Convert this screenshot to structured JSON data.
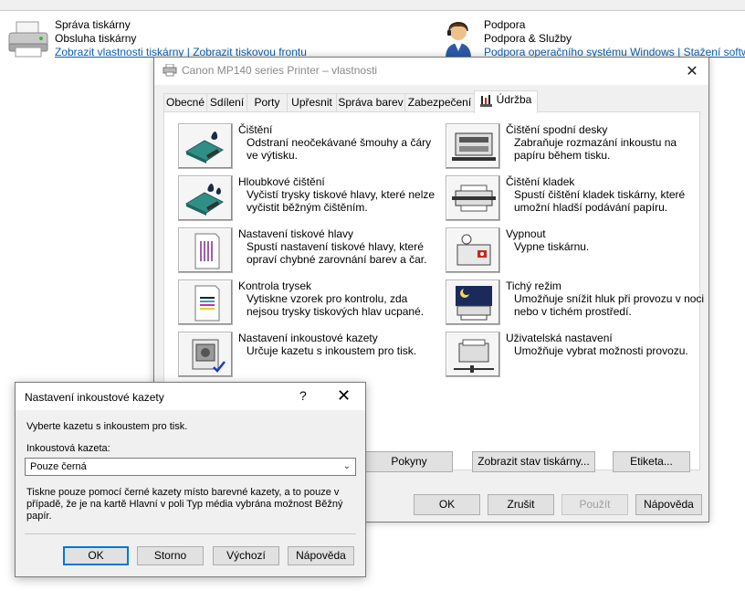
{
  "background": {
    "printer": {
      "title": "Správa tiskárny",
      "subtitle": "Obsluha tiskárny",
      "link1": "Zobrazit vlastnosti tiskárny",
      "link2": "Zobrazit tiskovou frontu"
    },
    "support": {
      "title": "Podpora",
      "subtitle": "Podpora & Služby",
      "link1": "Podpora operačního systému Windows",
      "link2": "Stažení softw"
    }
  },
  "window": {
    "title": "Canon MP140 series Printer – vlastnosti",
    "close": "✕",
    "tabs": [
      "Obecné",
      "Sdílení",
      "Porty",
      "Upřesnit",
      "Správa barev",
      "Zabezpečení",
      "Údržba"
    ],
    "active_tab": "Údržba",
    "left_items": [
      {
        "name": "Čištění",
        "desc": "Odstraní neočekávané šmouhy a čáry ve výtisku.",
        "icon": "cleaning-icon"
      },
      {
        "name": "Hloubkové čištění",
        "desc": "Vyčistí trysky tiskové hlavy, které nelze vyčistit běžným čištěním.",
        "icon": "deep-cleaning-icon"
      },
      {
        "name": "Nastavení tiskové hlavy",
        "desc": "Spustí nastavení tiskové hlavy, které opraví chybné zarovnání barev a čar.",
        "icon": "print-head-alignment-icon"
      },
      {
        "name": "Kontrola trysek",
        "desc": "Vytiskne vzorek pro kontrolu, zda nejsou trysky tiskových hlav ucpané.",
        "icon": "nozzle-check-icon"
      },
      {
        "name": "Nastavení inkoustové kazety",
        "desc": "Určuje kazetu s inkoustem pro tisk.",
        "icon": "ink-cartridge-icon"
      }
    ],
    "right_items": [
      {
        "name": "Čištění spodní desky",
        "desc": "Zabraňuje rozmazání inkoustu na papíru během tisku.",
        "icon": "bottom-plate-cleaning-icon"
      },
      {
        "name": "Čištění kladek",
        "desc": "Spustí čištění kladek tiskárny, které umožní hladší podávání papíru.",
        "icon": "roller-cleaning-icon"
      },
      {
        "name": "Vypnout",
        "desc": "Vypne tiskárnu.",
        "icon": "power-off-icon"
      },
      {
        "name": "Tichý režim",
        "desc": "Umožňuje snížit hluk při provozu v noci nebo v tichém prostředí.",
        "icon": "quiet-mode-icon"
      },
      {
        "name": "Uživatelská nastavení",
        "desc": "Umožňuje vybrat možnosti provozu.",
        "icon": "custom-settings-icon"
      }
    ],
    "panel_buttons": {
      "instructions": "Pokyny",
      "status": "Zobrazit stav tiskárny...",
      "label": "Etiketa..."
    },
    "buttons": {
      "ok": "OK",
      "cancel": "Zrušit",
      "apply": "Použít",
      "help": "Nápověda"
    }
  },
  "dialog": {
    "title": "Nastavení inkoustové kazety",
    "help_glyph": "?",
    "close_glyph": "✕",
    "instruction": "Vyberte kazetu s inkoustem pro tisk.",
    "field_label": "Inkoustová kazeta:",
    "selected": "Pouze černá",
    "note": "Tiskne pouze pomocí černé kazety místo barevné kazety, a to pouze v případě, že je na kartě Hlavní v poli Typ média vybrána možnost Běžný papír.",
    "buttons": {
      "ok": "OK",
      "cancel": "Storno",
      "defaults": "Výchozí",
      "help": "Nápověda"
    }
  }
}
